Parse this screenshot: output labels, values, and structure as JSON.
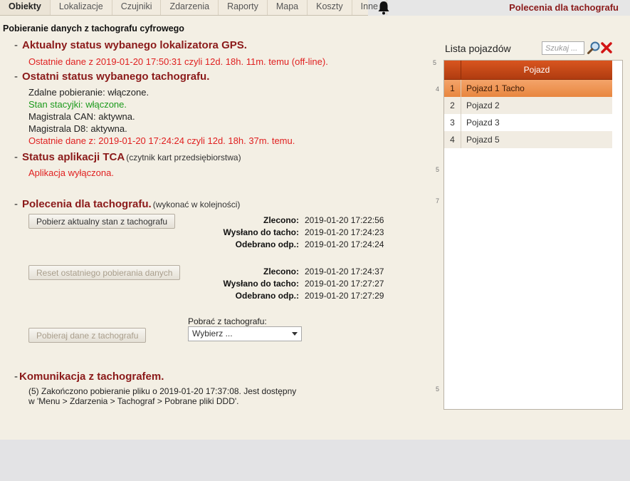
{
  "nav": {
    "tabs": [
      {
        "label": "Obiekty",
        "active": true
      },
      {
        "label": "Lokalizacje",
        "active": false
      },
      {
        "label": "Czujniki",
        "active": false
      },
      {
        "label": "Zdarzenia",
        "active": false
      },
      {
        "label": "Raporty",
        "active": false
      },
      {
        "label": "Mapa",
        "active": false
      },
      {
        "label": "Koszty",
        "active": false
      },
      {
        "label": "Inne",
        "active": false
      }
    ],
    "bell_icon": "bell-icon",
    "page_heading": "Polecenia dla tachografu"
  },
  "main": {
    "page_title": "Pobieranie danych z tachografu cyfrowego",
    "gps": {
      "title": "Aktualny status wybanego lokalizatora GPS.",
      "last_data": "Ostatnie dane z 2019-01-20 17:50:31 czyli 12d. 18h. 11m. temu (off-line)."
    },
    "tacho_status": {
      "title": "Ostatni status wybanego tachografu.",
      "remote_download": "Zdalne pobieranie: włączone.",
      "ignition": "Stan stacyjki: włączone.",
      "can_bus": "Magistrala CAN: aktywna.",
      "d8_bus": "Magistrala D8: aktywna.",
      "last_data": "Ostatnie dane z: 2019-01-20 17:24:24 czyli 12d. 18h. 37m. temu."
    },
    "tca": {
      "title": "Status aplikacji TCA",
      "subtitle": "(czytnik kart przedsiębiorstwa)",
      "status": "Aplikacja wyłączona."
    },
    "commands": {
      "title": "Polecenia dla tachografu.",
      "subtitle": "(wykonać w kolejności)",
      "labels": {
        "ordered": "Zlecono:",
        "sent": "Wysłano do tacho:",
        "received": "Odebrano odp.:"
      },
      "cmd1": {
        "button": "Pobierz aktualny stan z tachografu",
        "ordered": "2019-01-20 17:22:56",
        "sent": "2019-01-20 17:24:23",
        "received": "2019-01-20 17:24:24"
      },
      "cmd2": {
        "button": "Reset ostatniego pobierania danych",
        "ordered": "2019-01-20 17:24:37",
        "sent": "2019-01-20 17:27:27",
        "received": "2019-01-20 17:27:29"
      },
      "cmd3": {
        "button": "Pobieraj dane z tachografu",
        "download_label": "Pobrać z tachografu:",
        "select_value": "Wybierz ..."
      }
    },
    "communication": {
      "title": "Komunikacja z tachografem.",
      "line1": "(5) Zakończono pobieranie pliku o 2019-01-20 17:37:08. Jest dostępny",
      "line2": "w 'Menu > Zdarzenia > Tachograf > Pobrane pliki DDD'."
    },
    "side_numbers": [
      "5",
      "4",
      "5",
      "7",
      "5"
    ]
  },
  "vehicles": {
    "title": "Lista pojazdów",
    "search_placeholder": "Szukaj ...",
    "search_icon": "magnifier-icon",
    "clear_icon": "red-x-icon",
    "column": "Pojazd",
    "rows": [
      {
        "n": "1",
        "name": "Pojazd 1 Tacho",
        "selected": true
      },
      {
        "n": "2",
        "name": "Pojazd 2",
        "selected": false
      },
      {
        "n": "3",
        "name": "Pojazd 3",
        "selected": false
      },
      {
        "n": "4",
        "name": "Pojazd 5",
        "selected": false
      }
    ]
  },
  "colors": {
    "heading_red": "#8b1a1a",
    "alert_red": "#e02020",
    "ok_green": "#1c9a1c",
    "header_orange": "#c4481a",
    "selected_orange": "#ec8e48",
    "panel_beige": "#f3efe4"
  }
}
